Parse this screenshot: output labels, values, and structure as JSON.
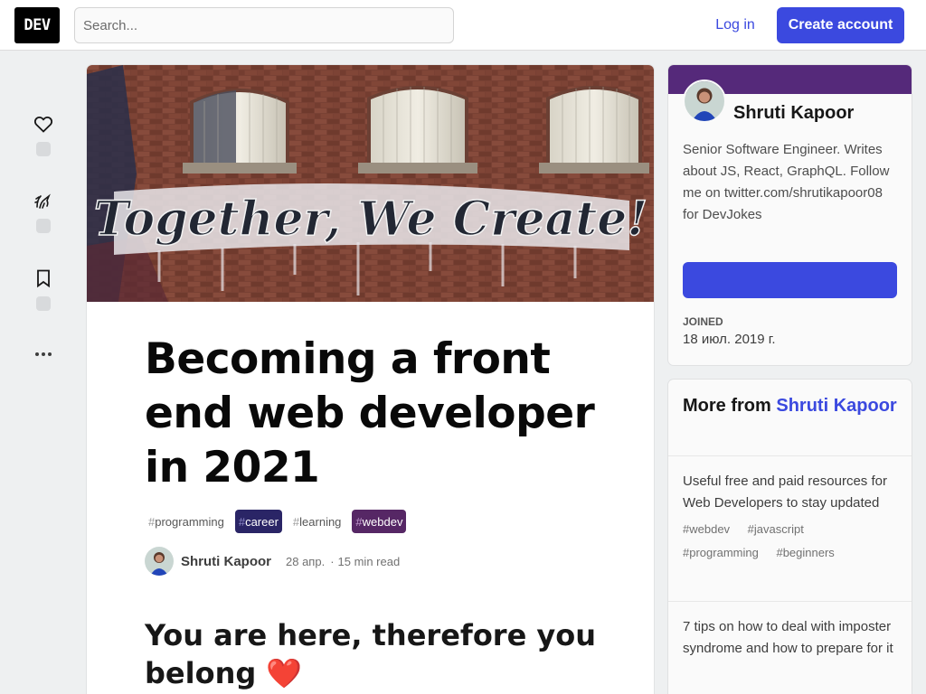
{
  "header": {
    "logo": "DEV",
    "search_placeholder": "Search...",
    "login_label": "Log in",
    "create_account_label": "Create account"
  },
  "reactions": [
    {
      "name": "heart",
      "icon": "heart-icon"
    },
    {
      "name": "unicorn",
      "icon": "unicorn-icon"
    },
    {
      "name": "bookmark",
      "icon": "bookmark-icon"
    },
    {
      "name": "more",
      "icon": "more-dots-icon"
    }
  ],
  "article": {
    "cover_text": "Together, We Create!",
    "title": "Becoming a front end web developer in 2021",
    "tags": [
      {
        "label": "programming",
        "style": "plain"
      },
      {
        "label": "career",
        "style": "career"
      },
      {
        "label": "learning",
        "style": "plain"
      },
      {
        "label": "webdev",
        "style": "webdev"
      }
    ],
    "author": "Shruti Kapoor",
    "date": "28 апр.",
    "read_time": "15 min read",
    "subheading": "You are here, therefore you belong ❤️"
  },
  "profile": {
    "name": "Shruti Kapoor",
    "bio": "Senior Software Engineer. Writes about JS, React, GraphQL. Follow me on twitter.com/shrutikapoor08 for DevJokes",
    "joined_label": "JOINED",
    "joined_date": "18 июл. 2019 г.",
    "brand_color": "#55297a"
  },
  "more_from": {
    "prefix": "More from",
    "author": "Shruti Kapoor",
    "items": [
      {
        "title": "Useful free and paid resources for Web Developers to stay updated",
        "tags": [
          "webdev",
          "javascript",
          "programming",
          "beginners"
        ]
      },
      {
        "title": "7 tips on how to deal with imposter syndrome and how to prepare for it",
        "tags": []
      }
    ]
  },
  "colors": {
    "accent": "#3b49df",
    "background": "#eef0f1"
  }
}
